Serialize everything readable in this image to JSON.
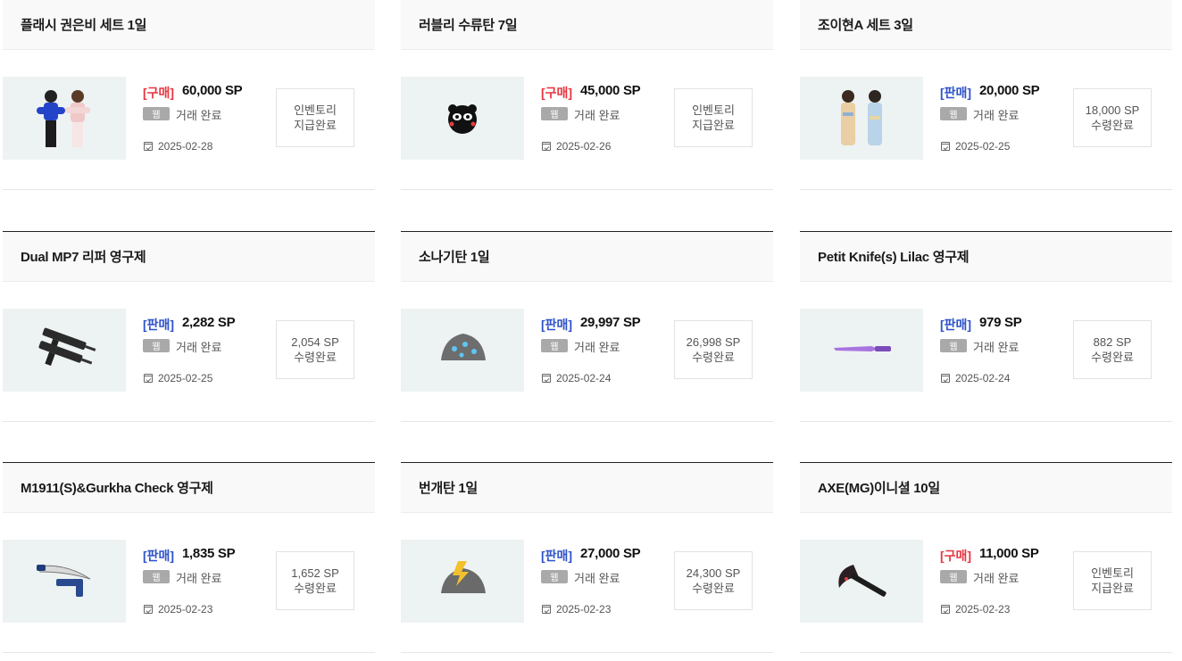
{
  "items": [
    {
      "title": "플래시 권은비 세트 1일",
      "trade_type": "[구매]",
      "kind": "buy",
      "price": "60,000 SP",
      "badge": "웹",
      "status": "거래 완료",
      "date": "2025-02-28",
      "action_line1": "인벤토리",
      "action_line2": "지급완료",
      "icon": "two-women-character-icon"
    },
    {
      "title": "러블리 수류탄 7일",
      "trade_type": "[구매]",
      "kind": "buy",
      "price": "45,000 SP",
      "badge": "웹",
      "status": "거래 완료",
      "date": "2025-02-26",
      "action_line1": "인벤토리",
      "action_line2": "지급완료",
      "icon": "panda-grenade-icon"
    },
    {
      "title": "조이현A 세트 3일",
      "trade_type": "[판매]",
      "kind": "sell",
      "price": "20,000 SP",
      "badge": "웹",
      "status": "거래 완료",
      "date": "2025-02-25",
      "action_line1": "18,000 SP",
      "action_line2": "수령완료",
      "icon": "two-women-floral-icon"
    },
    {
      "title": "Dual MP7 리퍼 영구제",
      "trade_type": "[판매]",
      "kind": "sell",
      "price": "2,282 SP",
      "badge": "웹",
      "status": "거래 완료",
      "date": "2025-02-25",
      "action_line1": "2,054 SP",
      "action_line2": "수령완료",
      "icon": "dual-smg-icon"
    },
    {
      "title": "소나기탄 1일",
      "trade_type": "[판매]",
      "kind": "sell",
      "price": "29,997 SP",
      "badge": "웹",
      "status": "거래 완료",
      "date": "2025-02-24",
      "action_line1": "26,998 SP",
      "action_line2": "수령완료",
      "icon": "rock-grenade-icon"
    },
    {
      "title": "Petit Knife(s) Lilac 영구제",
      "trade_type": "[판매]",
      "kind": "sell",
      "price": "979 SP",
      "badge": "웹",
      "status": "거래 완료",
      "date": "2025-02-24",
      "action_line1": "882 SP",
      "action_line2": "수령완료",
      "icon": "lilac-knife-icon"
    },
    {
      "title": "M1911(S)&Gurkha Check 영구제",
      "trade_type": "[판매]",
      "kind": "sell",
      "price": "1,835 SP",
      "badge": "웹",
      "status": "거래 완료",
      "date": "2025-02-23",
      "action_line1": "1,652 SP",
      "action_line2": "수령완료",
      "icon": "pistol-kukri-icon"
    },
    {
      "title": "번개탄 1일",
      "trade_type": "[판매]",
      "kind": "sell",
      "price": "27,000 SP",
      "badge": "웹",
      "status": "거래 완료",
      "date": "2025-02-23",
      "action_line1": "24,300 SP",
      "action_line2": "수령완료",
      "icon": "lightning-grenade-icon"
    },
    {
      "title": "AXE(MG)이니셜 10일",
      "trade_type": "[구매]",
      "kind": "buy",
      "price": "11,000 SP",
      "badge": "웹",
      "status": "거래 완료",
      "date": "2025-02-23",
      "action_line1": "인벤토리",
      "action_line2": "지급완료",
      "icon": "axe-icon"
    }
  ]
}
